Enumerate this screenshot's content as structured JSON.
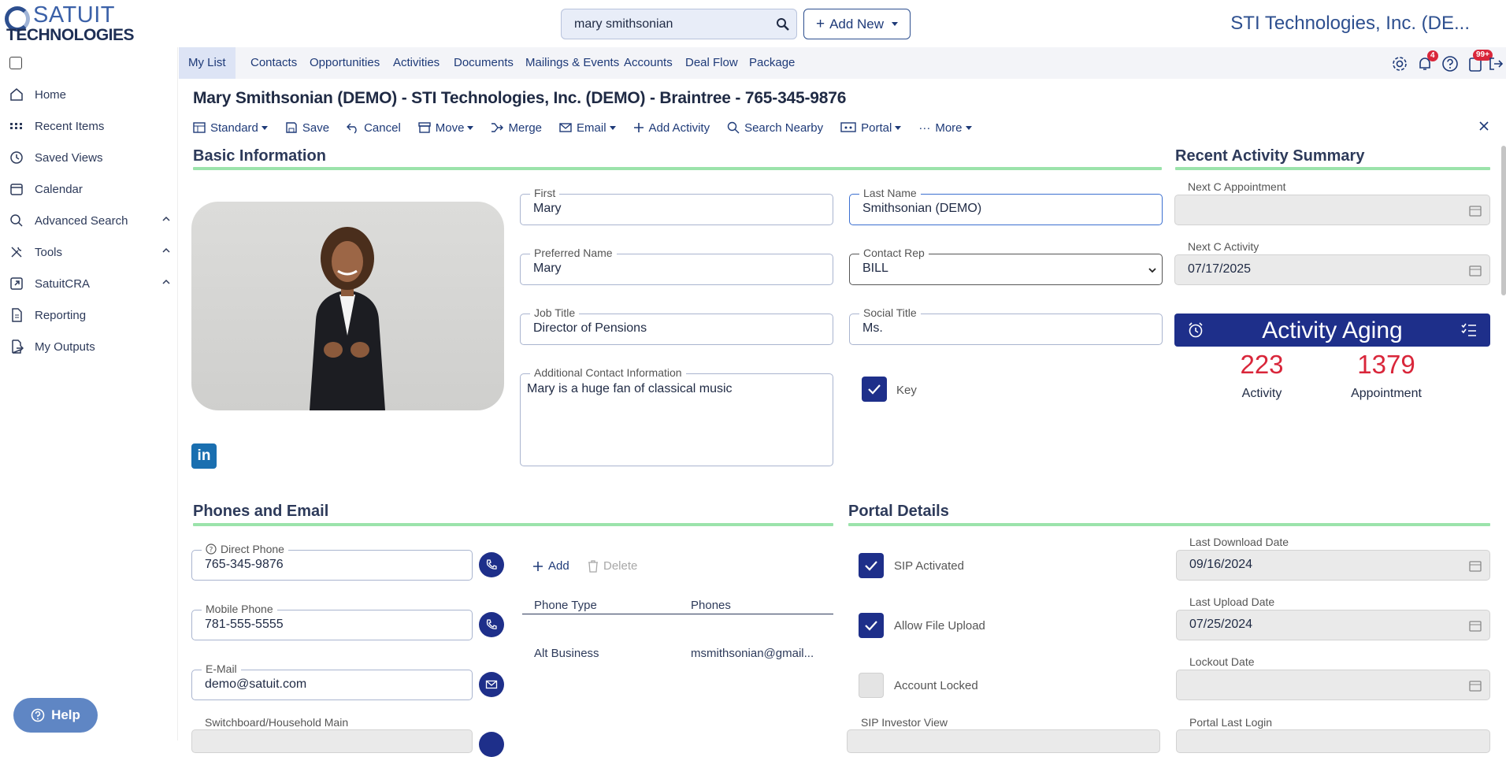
{
  "app": {
    "logo_word_1": "SATUIT",
    "logo_word_2": "TECHNOLOGIES",
    "company": "STI Technologies, Inc. (DE...",
    "colors": {
      "brand": "#1e2f8a",
      "accent_line": "#9be3ab",
      "badge": "#d9263a"
    }
  },
  "search": {
    "value": "mary smithsonian"
  },
  "add_new": {
    "label": "Add New"
  },
  "sidebar": {
    "items": [
      {
        "label": "Home",
        "icon": "home-icon"
      },
      {
        "label": "Recent Items",
        "icon": "grid-icon"
      },
      {
        "label": "Saved Views",
        "icon": "history-icon"
      },
      {
        "label": "Calendar",
        "icon": "calendar-icon"
      },
      {
        "label": "Advanced Search",
        "icon": "search-icon",
        "expandable": true
      },
      {
        "label": "Tools",
        "icon": "tools-icon",
        "expandable": true
      },
      {
        "label": "SatuitCRA",
        "icon": "external-icon",
        "expandable": true
      },
      {
        "label": "Reporting",
        "icon": "document-icon"
      },
      {
        "label": "My Outputs",
        "icon": "export-icon"
      }
    ]
  },
  "tabs": [
    "My List",
    "Contacts",
    "Opportunities",
    "Activities",
    "Documents",
    "Mailings & Events",
    "Accounts",
    "Deal Flow",
    "Package"
  ],
  "top_icons": {
    "notifications_badge": "4",
    "cart_badge": "99+"
  },
  "record": {
    "title": "Mary Smithsonian (DEMO) - STI Technologies, Inc. (DEMO) - Braintree - 765-345-9876"
  },
  "toolbar": {
    "standard": "Standard",
    "save": "Save",
    "cancel": "Cancel",
    "move": "Move",
    "merge": "Merge",
    "email": "Email",
    "add_activity": "Add Activity",
    "search_nearby": "Search Nearby",
    "portal": "Portal",
    "more": "More"
  },
  "basic": {
    "heading": "Basic Information",
    "first_label": "First",
    "first": "Mary",
    "last_label": "Last Name",
    "last": "Smithsonian (DEMO)",
    "preferred_label": "Preferred Name",
    "preferred": "Mary",
    "rep_label": "Contact Rep",
    "rep": "BILL",
    "job_label": "Job Title",
    "job": "Director of Pensions",
    "social_label": "Social Title",
    "social": "Ms.",
    "additional_label": "Additional Contact Information",
    "additional": "Mary is a huge fan of classical music",
    "key_label": "Key",
    "key_checked": true,
    "linkedin": "in"
  },
  "recent": {
    "heading": "Recent Activity Summary",
    "next_appt_label": "Next C Appointment",
    "next_appt": "",
    "next_activity_label": "Next C Activity",
    "next_activity": "07/17/2025",
    "aging_title": "Activity Aging",
    "activity_count": "223",
    "activity_label": "Activity",
    "appointment_count": "1379",
    "appointment_label": "Appointment"
  },
  "phones": {
    "heading": "Phones and Email",
    "direct_label": "Direct Phone",
    "direct": "765-345-9876",
    "mobile_label": "Mobile Phone",
    "mobile": "781-555-5555",
    "email_label": "E-Mail",
    "email": "demo@satuit.com",
    "switchboard_label": "Switchboard/Household Main",
    "add": "Add",
    "delete": "Delete",
    "col_type": "Phone Type",
    "col_phones": "Phones",
    "row_type": "Alt Business",
    "row_phone": "msmithsonian@gmail..."
  },
  "portal": {
    "heading": "Portal Details",
    "sip_label": "SIP Activated",
    "sip_checked": true,
    "upload_label": "Allow File Upload",
    "upload_checked": true,
    "locked_label": "Account Locked",
    "locked_checked": false,
    "investor_label": "SIP Investor View",
    "last_download_label": "Last Download Date",
    "last_download": "09/16/2024",
    "last_upload_label": "Last Upload Date",
    "last_upload": "07/25/2024",
    "lockout_label": "Lockout Date",
    "lockout": "",
    "last_login_label": "Portal Last Login"
  },
  "help": {
    "label": "Help"
  }
}
